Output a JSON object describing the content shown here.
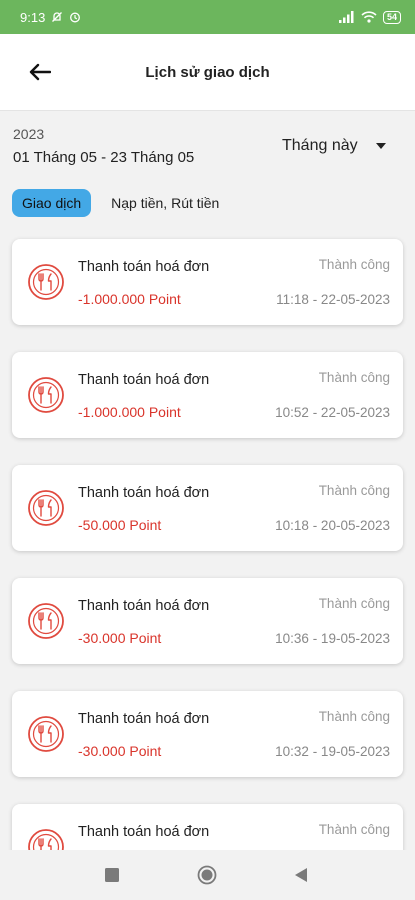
{
  "status_bar": {
    "time": "9:13",
    "battery": "54"
  },
  "header": {
    "title": "Lịch sử giao dịch"
  },
  "filter": {
    "year": "2023",
    "date_range": "01 Tháng 05 - 23 Tháng 05",
    "period": "Tháng này"
  },
  "tabs": [
    {
      "label": "Giao dịch",
      "active": true
    },
    {
      "label": "Nạp tiền, Rút tiền",
      "active": false
    }
  ],
  "transactions": [
    {
      "title": "Thanh toán hoá đơn",
      "amount": "-1.000.000 Point",
      "status": "Thành công",
      "time": "11:18 - 22-05-2023"
    },
    {
      "title": "Thanh toán hoá đơn",
      "amount": "-1.000.000 Point",
      "status": "Thành công",
      "time": "10:52 - 22-05-2023"
    },
    {
      "title": "Thanh toán hoá đơn",
      "amount": "-50.000 Point",
      "status": "Thành công",
      "time": "10:18 - 20-05-2023"
    },
    {
      "title": "Thanh toán hoá đơn",
      "amount": "-30.000 Point",
      "status": "Thành công",
      "time": "10:36 - 19-05-2023"
    },
    {
      "title": "Thanh toán hoá đơn",
      "amount": "-30.000 Point",
      "status": "Thành công",
      "time": "10:32 - 19-05-2023"
    },
    {
      "title": "Thanh toán hoá đơn",
      "amount": "",
      "status": "Thành công",
      "time": ""
    }
  ],
  "colors": {
    "status_bar": "#6cb65d",
    "accent_tab": "#43a8e6",
    "amount": "#d9342b",
    "icon": "#e04a3f"
  },
  "icons": {
    "back": "arrow-left-icon",
    "transaction": "restaurant-icon",
    "period_dropdown": "caret-down-icon",
    "nav": [
      "square-icon",
      "circle-home-icon",
      "triangle-back-icon"
    ]
  }
}
